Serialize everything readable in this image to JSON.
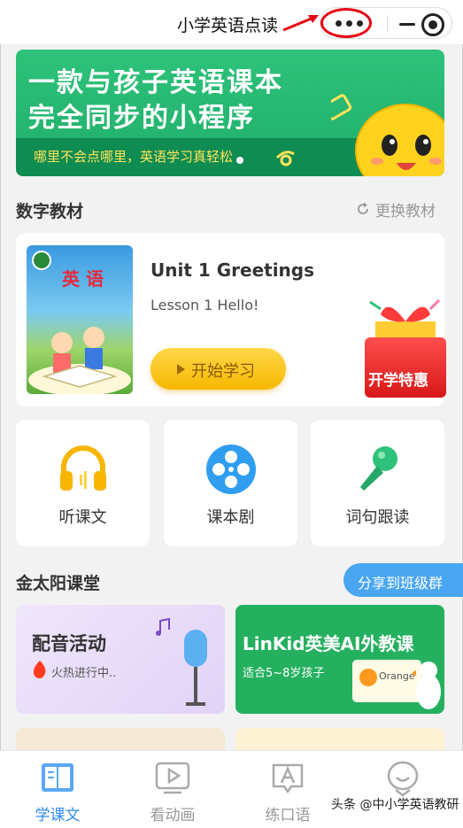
{
  "header": {
    "title": "小学英语点读"
  },
  "banner": {
    "line1": "一款与孩子英语课本",
    "line2": "完全同步的小程序",
    "sub": "哪里不会点哪里，英语学习真轻松"
  },
  "digital": {
    "title": "数字教材",
    "change_label": "更换教材"
  },
  "book": {
    "cover_title": "英 语",
    "unit": "Unit 1 Greetings",
    "lesson": "Lesson 1 Hello!",
    "start_label": "开始学习",
    "gift_label": "开学特惠"
  },
  "features": [
    {
      "label": "听课文",
      "icon": "headphones-icon"
    },
    {
      "label": "课本剧",
      "icon": "film-reel-icon"
    },
    {
      "label": "词句跟读",
      "icon": "microphone-icon"
    }
  ],
  "classroom": {
    "title": "金太阳课堂",
    "share_label": "分享到班级群"
  },
  "promos": [
    {
      "title": "配音活动",
      "subtitle": "火热进行中..",
      "badge": "HOT"
    },
    {
      "title": "LinKid英美AI外教课",
      "subtitle": "适合5~8岁孩子",
      "card_word": "Orange"
    }
  ],
  "tabs": [
    {
      "label": "学课文",
      "icon": "book-icon",
      "active": true
    },
    {
      "label": "看动画",
      "icon": "video-play-icon",
      "active": false
    },
    {
      "label": "练口语",
      "icon": "speech-a-icon",
      "active": false
    },
    {
      "label": "",
      "icon": "avatar-icon",
      "active": false
    }
  ],
  "watermark": "头条 @中小学英语教研",
  "colors": {
    "brand_green": "#1fae6b",
    "accent_blue": "#2f8cf0",
    "button_yellow": "#f6b800",
    "annotation_red": "#e60012"
  }
}
